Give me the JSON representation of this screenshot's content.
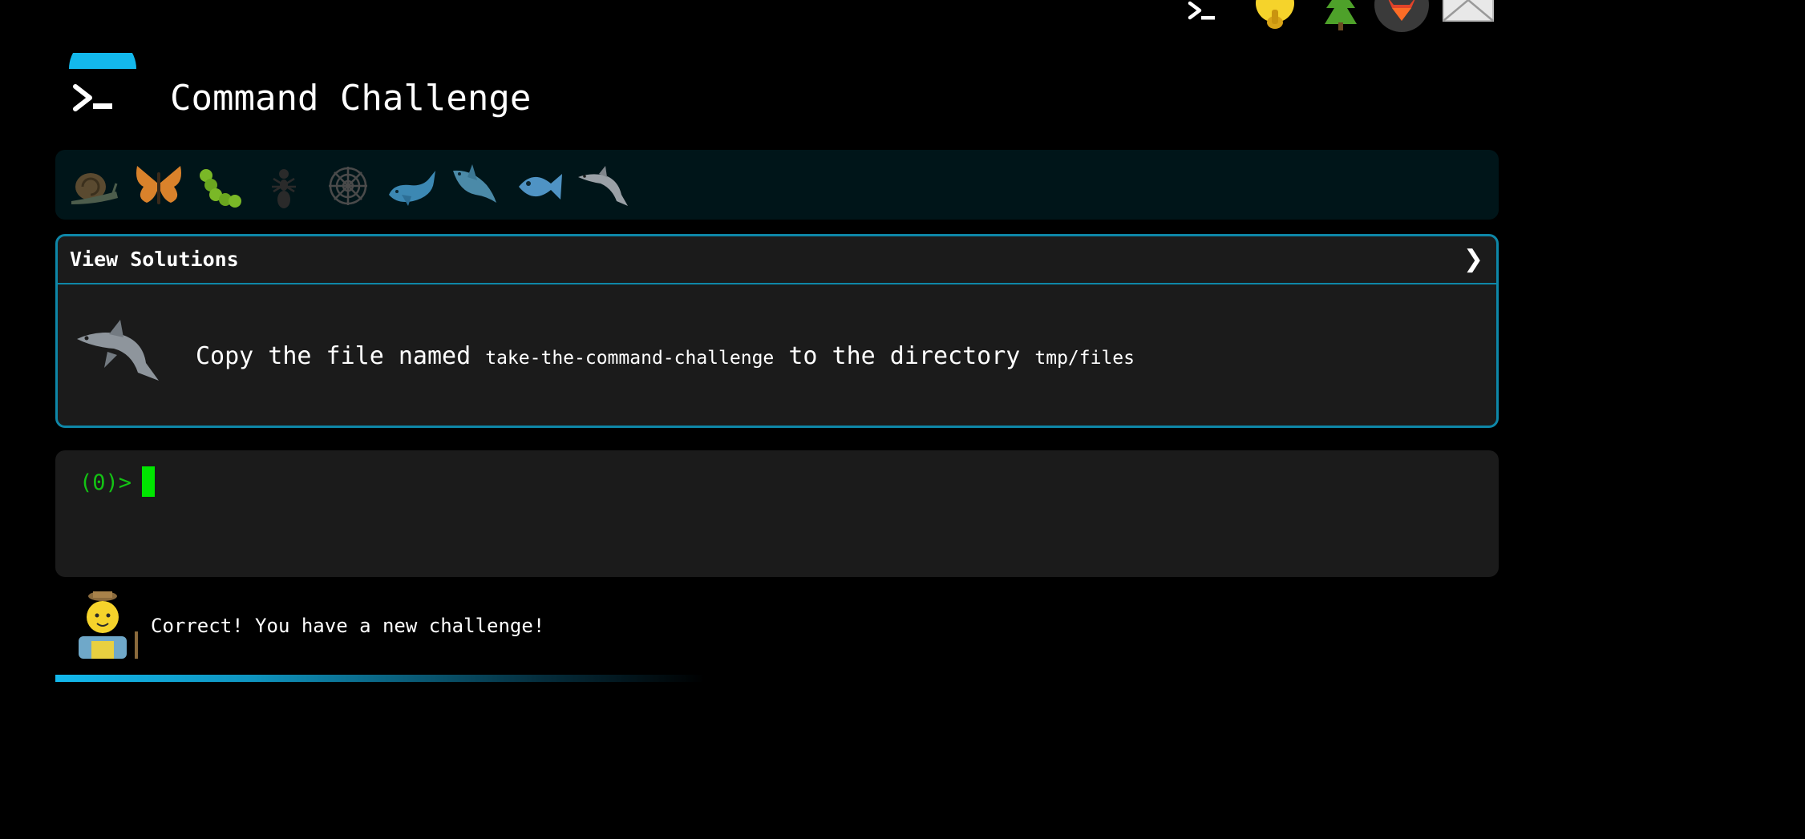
{
  "top_icons": [
    {
      "name": "terminal-icon"
    },
    {
      "name": "face-icon"
    },
    {
      "name": "tree-icon"
    },
    {
      "name": "gitlab-icon"
    },
    {
      "name": "mail-icon"
    }
  ],
  "header": {
    "title": "Command Challenge"
  },
  "levels": [
    {
      "name": "snail-icon"
    },
    {
      "name": "butterfly-icon"
    },
    {
      "name": "caterpillar-icon"
    },
    {
      "name": "ant-icon"
    },
    {
      "name": "spider-web-icon"
    },
    {
      "name": "whale-icon"
    },
    {
      "name": "shark-icon"
    },
    {
      "name": "fish-icon"
    },
    {
      "name": "dolphin-icon"
    }
  ],
  "panel": {
    "toggle_label": "View Solutions",
    "toggle_icon": "chevron-right-icon",
    "challenge_icon": "dolphin-icon",
    "text_before": "Copy the file named ",
    "file_name": "take-the-command-challenge",
    "text_middle": " to the directory ",
    "directory": "tmp/files"
  },
  "terminal": {
    "prompt": "(0)>",
    "input_value": ""
  },
  "feedback": {
    "avatar": "farmer-icon",
    "message": "Correct! You have a new challenge!"
  },
  "progress": {
    "fraction": 0.45
  },
  "colors": {
    "background": "#000000",
    "level_bar": "#001519",
    "panel": "#1b1b1b",
    "accent_border": "#0e87a8",
    "prompt": "#14c214",
    "cursor": "#00e600",
    "progress": "#13b8ec"
  }
}
